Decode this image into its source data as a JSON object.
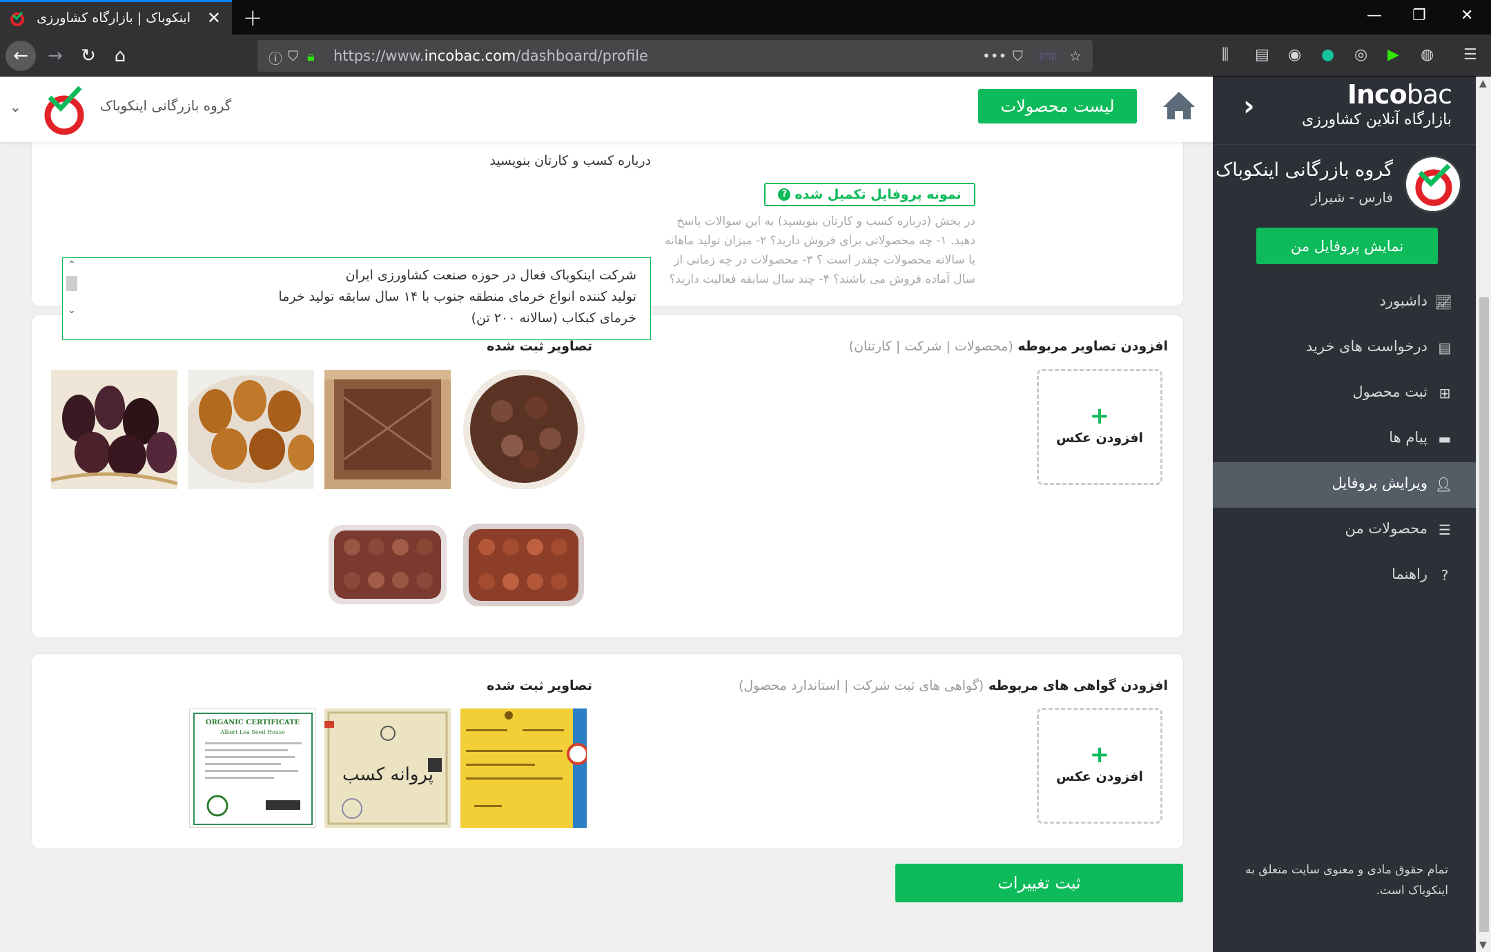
{
  "browser": {
    "tab_title": "اینکوباک | بازارگاه کشاورزی",
    "url_prefix": "https://www.",
    "url_domain": "incobac.com",
    "url_path": "/dashboard/profile"
  },
  "header": {
    "products_button": "لیست محصولات",
    "company_name": "گروه بازرگانی اینکوباک"
  },
  "sidebar": {
    "logo_bold": "Inco",
    "logo_thin": "bac",
    "tagline": "بازارگاه آنلاین کشاورزی",
    "company_name": "گروه بازرگانی اینکوباک",
    "location": "فارس - شیراز",
    "show_profile_button": "نمایش پروفایل من",
    "menu": [
      {
        "label": "داشبورد",
        "icon": "chart-icon"
      },
      {
        "label": "درخواست های خرید",
        "icon": "list-icon"
      },
      {
        "label": "ثبت محصول",
        "icon": "plus-square-icon"
      },
      {
        "label": "پیام ها",
        "icon": "message-icon"
      },
      {
        "label": "ویرایش پروفایل",
        "icon": "user-icon",
        "active": true
      },
      {
        "label": "محصولات من",
        "icon": "list-ul-icon"
      },
      {
        "label": "راهنما",
        "icon": "question-icon"
      }
    ],
    "footer": "تمام حقوق مادی و معنوی سایت متعلق به اینکوباک است."
  },
  "about": {
    "sample_badge": "نمونه پروفایل تکمیل شده",
    "help_text": "در بخش (درباره کسب و کارتان بنویسید) به این سوالات پاسخ دهید. ۱- چه محصولاتی برای فروش دارید؟ ۲- میزان تولید ماهانه یا سالانه محصولات چقدر است ؟ ۳- محصولات در چه زمانی از سال آماده فروش می باشند؟ ۴- چند سال سابقه فعالیت دارید؟",
    "label": "درباره کسب و کارتان بنویسید",
    "line1": "شرکت اینکوباک فعال در حوزه صنعت کشاورزی ایران",
    "line2": "تولید کننده انواع خرمای منطقه جنوب با ۱۴ سال سابقه تولید خرما",
    "line3": "خرمای کبکاب (سالانه ۲۰۰ تن)"
  },
  "images_section": {
    "title": "افزودن تصاویر مربوطه",
    "subtitle": "(محصولات | شرکت | کارتنان)",
    "uploaded_title": "تصاویر ثبت شده",
    "add_label": "افزودن عکس",
    "plus": "+"
  },
  "certs_section": {
    "title": "افزودن گواهی های مربوطه",
    "subtitle": "(گواهی های ثبت شرکت | استاندارد محصول)",
    "uploaded_title": "تصاویر ثبت شده",
    "add_label": "افزودن عکس",
    "plus": "+",
    "cert1_title": "ORGANIC CERTIFICATE",
    "cert1_sub": "Albert Lea Seed House",
    "cert2_text": "پروانه کسب"
  },
  "save_button": "ثبت تغییرات"
}
